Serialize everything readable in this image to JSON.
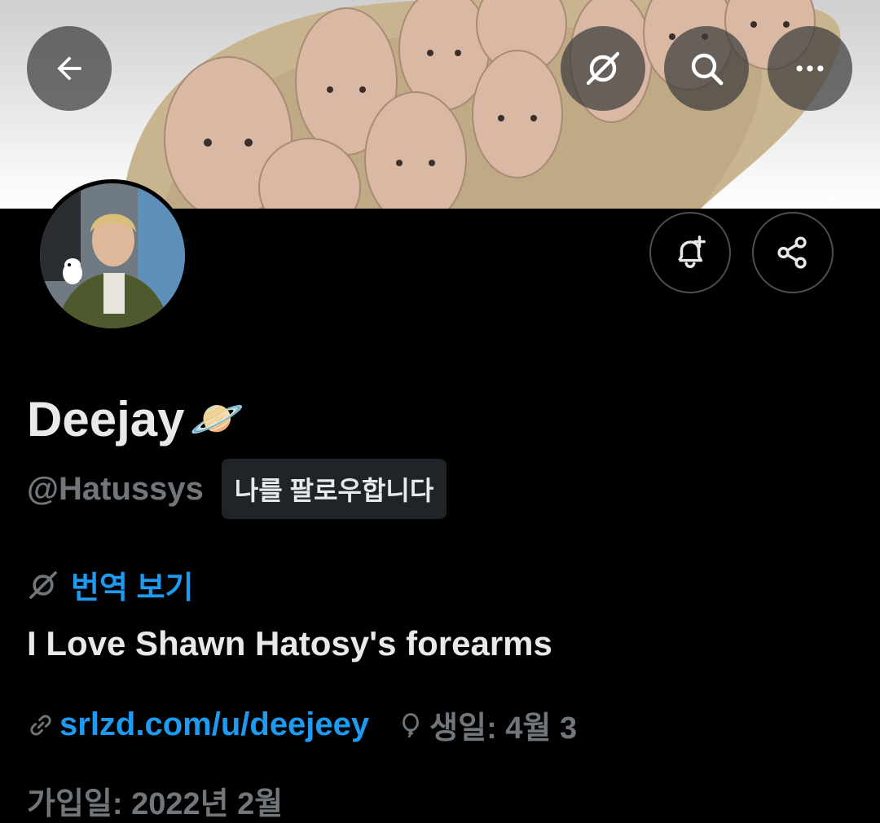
{
  "header": {
    "back_icon": "arrow-left-icon",
    "translate_icon": "translate-icon",
    "search_icon": "search-icon",
    "more_icon": "more-horizontal-icon"
  },
  "actions": {
    "notify_icon": "bell-plus-icon",
    "share_icon": "share-icon"
  },
  "profile": {
    "display_name": "Deejay",
    "name_emoji": "🪐",
    "handle": "@Hatussys",
    "follows_you": "나를 팔로우합니다",
    "translate_label": "번역 보기",
    "bio": "I Love Shawn Hatosy's forearms",
    "link": "srlzd.com/u/deejeey",
    "birthday": "생일: 4월 3",
    "next_line": "가입일: 2022년 2월"
  },
  "colors": {
    "accent": "#1d9bf0",
    "secondary_text": "#71767b",
    "background": "#000000"
  }
}
